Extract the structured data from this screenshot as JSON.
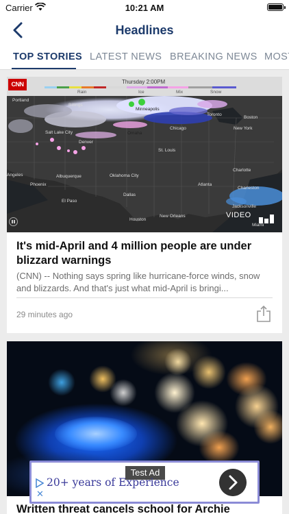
{
  "status": {
    "carrier": "Carrier",
    "time": "10:21 AM"
  },
  "nav": {
    "title": "Headlines"
  },
  "tabs": [
    {
      "label": "TOP STORIES",
      "active": true
    },
    {
      "label": "LATEST NEWS",
      "active": false
    },
    {
      "label": "BREAKING NEWS",
      "active": false
    },
    {
      "label": "MOST",
      "active": false
    }
  ],
  "articles": [
    {
      "media_type": "video",
      "map": {
        "brand": "CNN",
        "time_label": "Thursday 2:00PM",
        "legend": [
          "Rain",
          "Ice",
          "Mix",
          "Snow"
        ],
        "cities": [
          "Portland",
          "Billings",
          "Minneapolis",
          "Toronto",
          "Boston",
          "New York",
          "Salt Lake City",
          "Denver",
          "Omaha",
          "Chicago",
          "St. Louis",
          "Charlotte",
          "Angeles",
          "Phoenix",
          "Albuquerque",
          "Oklahoma City",
          "Atlanta",
          "Charleston",
          "El Paso",
          "Dallas",
          "Houston",
          "New Orleans",
          "Jacksonville",
          "Miami"
        ],
        "video_label": "VIDEO"
      },
      "headline": "It's mid-April and 4 million people are under blizzard warnings",
      "summary": "(CNN) -- Nothing says spring like hurricane-force winds, snow and blizzards. And that's just what mid-April is bringi...",
      "timestamp": "29 minutes ago"
    },
    {
      "media_type": "image",
      "headline": "Written threat cancels school for Archie"
    }
  ],
  "ad": {
    "tag": "Test Ad",
    "text": "20+ years of Experience",
    "close": "✕"
  },
  "colors": {
    "brand_navy": "#1c3a6b",
    "cnn_red": "#cc0000",
    "ad_border": "#8b8bd6"
  },
  "icons": [
    "wifi-icon",
    "battery-icon",
    "back-chevron-icon",
    "pause-icon",
    "video-bars-icon",
    "share-icon",
    "ad-play-icon",
    "ad-close-icon",
    "chevron-right-icon"
  ]
}
